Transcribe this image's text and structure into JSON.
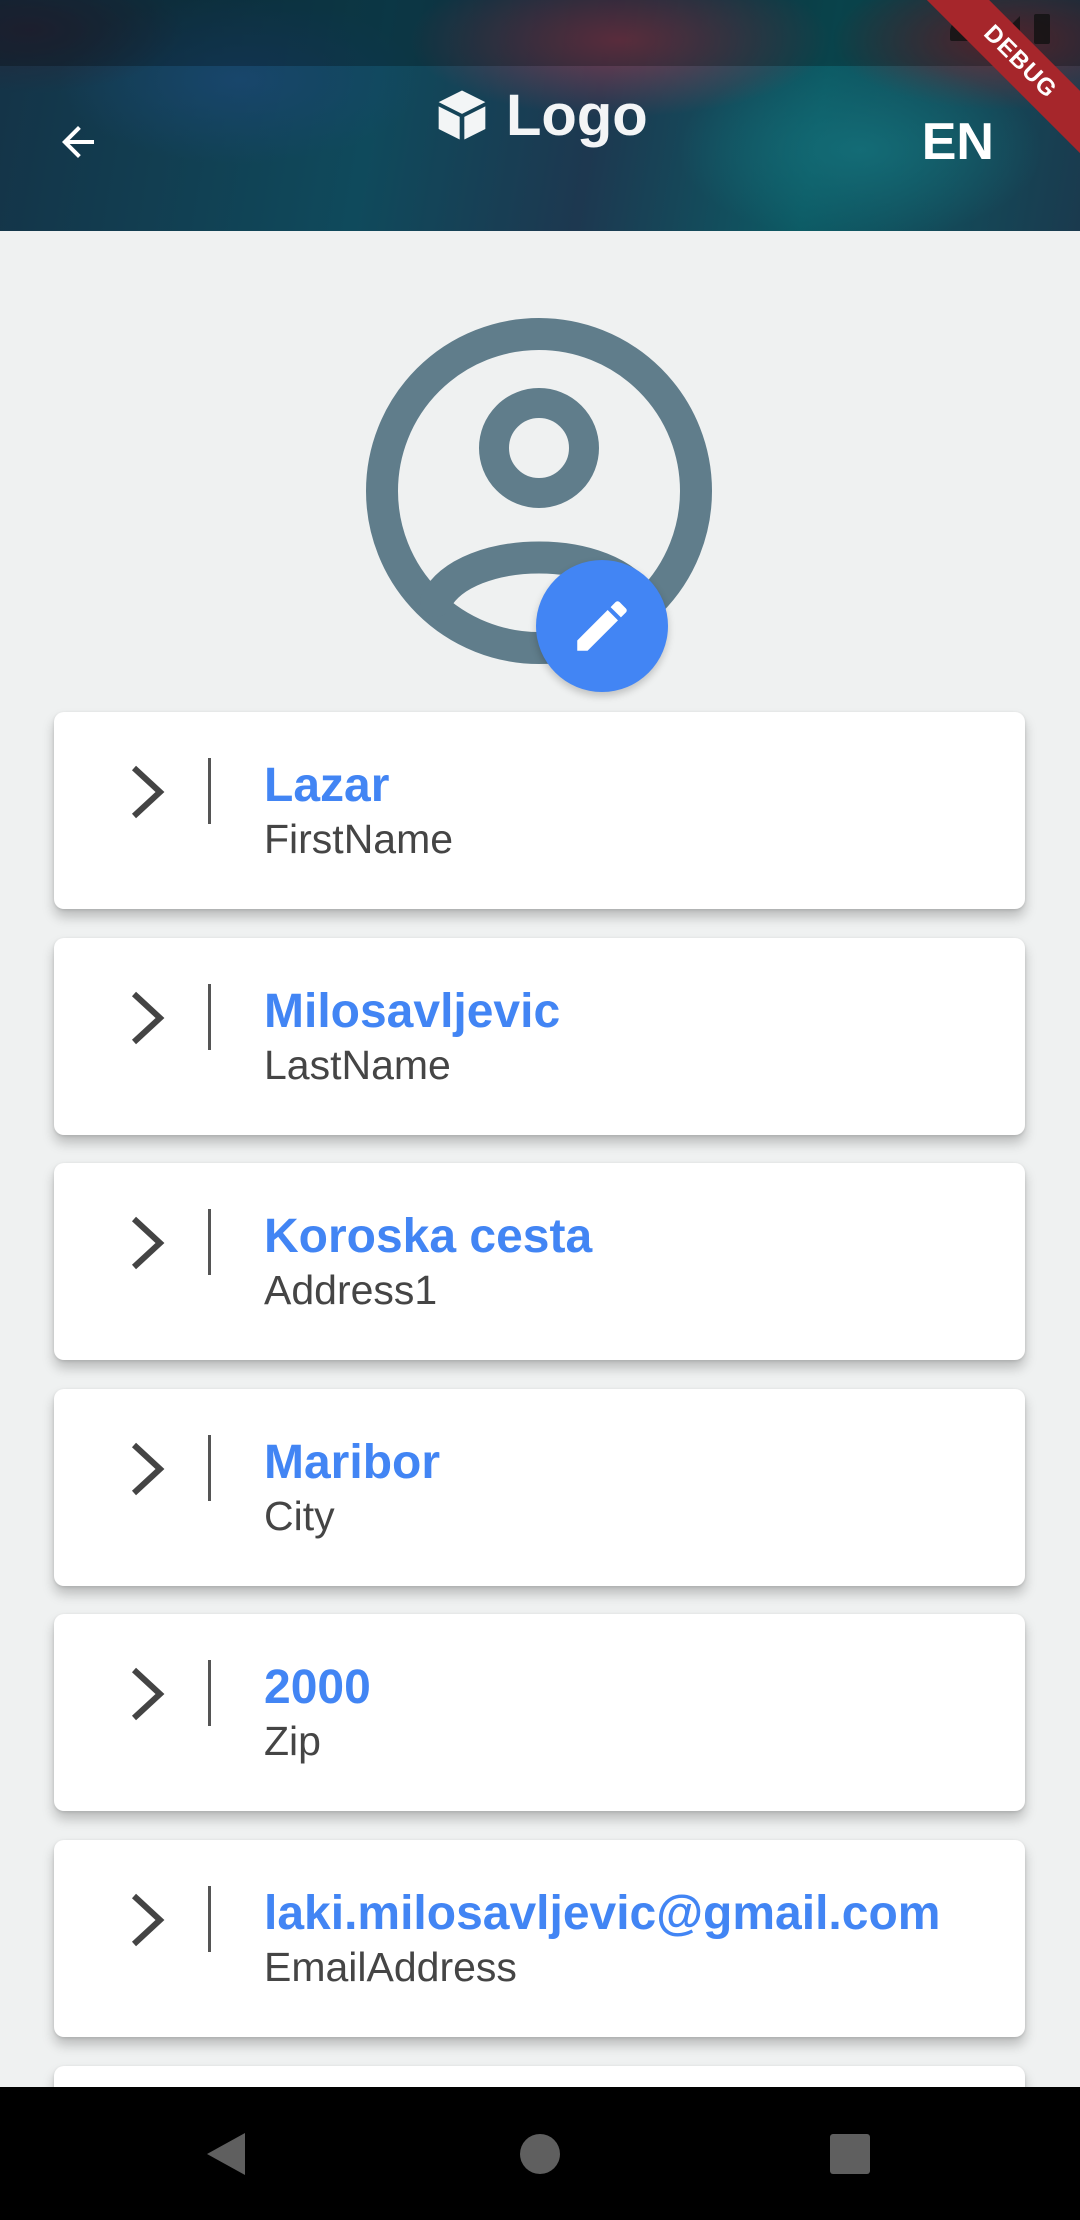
{
  "header": {
    "logo_text": "Logo",
    "language": "EN",
    "debug_banner": "DEBUG",
    "icons": [
      "arrow-back-icon",
      "cube-logo-icon"
    ]
  },
  "profile": {
    "avatar_icon": "account-circle-icon",
    "edit_icon": "pencil-icon",
    "accent_color": "#4285f4",
    "avatar_color": "#607d8b"
  },
  "fields": [
    {
      "value": "Lazar",
      "label": "FirstName"
    },
    {
      "value": "Milosavljevic",
      "label": "LastName"
    },
    {
      "value": "Koroska cesta",
      "label": "Address1"
    },
    {
      "value": "Maribor",
      "label": "City"
    },
    {
      "value": "2000",
      "label": "Zip"
    },
    {
      "value": "laki.milosavljevic@gmail.com",
      "label": "EmailAddress"
    }
  ],
  "navbar": {
    "icons": [
      "nav-back-icon",
      "nav-home-icon",
      "nav-recents-icon"
    ]
  }
}
